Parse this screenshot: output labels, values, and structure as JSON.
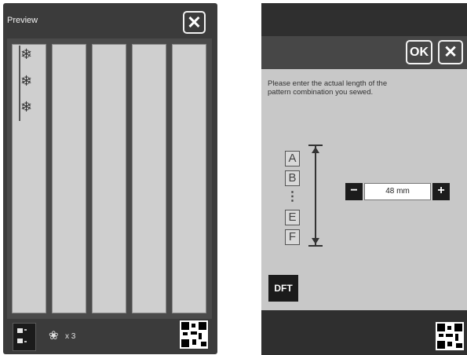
{
  "left_screen": {
    "title": "Preview",
    "close_label": "✕",
    "strip_count": 5,
    "repeat_count": "x 3",
    "icons": [
      "layout-icon",
      "repeat-stitch-icon",
      "qr-code-icon",
      "snowflake-stitch-icon"
    ]
  },
  "right_screen": {
    "ok_label": "OK",
    "close_label": "✕",
    "instruction": "Please enter the actual length of the pattern combination you sewed.",
    "pattern_letters": [
      "A",
      "B",
      "E",
      "F"
    ],
    "pattern_dots": "⋮",
    "length_value": "48 mm",
    "minus_label": "−",
    "plus_label": "+",
    "dft_label": "DFT",
    "icons": [
      "qr-code-icon",
      "measure-arrow-icon"
    ]
  },
  "colors": {
    "panel_dark": "#3b3b3b",
    "strip": "#cfcfcf",
    "right_body": "#c8c8c8",
    "button_dark": "#1c1c1c"
  }
}
